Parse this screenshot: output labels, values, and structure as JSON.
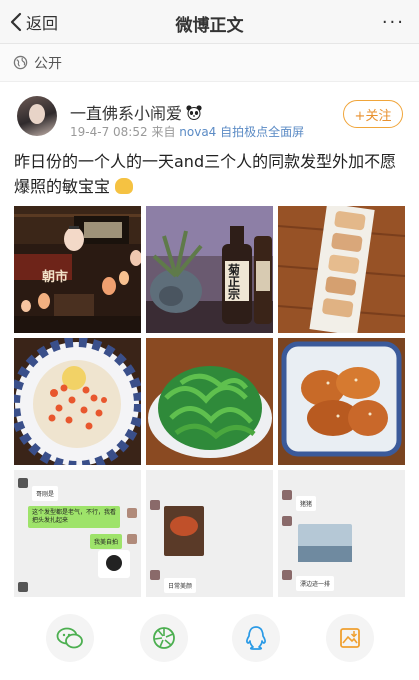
{
  "nav": {
    "back_label": "返回",
    "title": "微博正文",
    "more": "···"
  },
  "visibility": {
    "label": "公开"
  },
  "post": {
    "username": "一直佛系小闹爱",
    "time": "19-4-7 08:52",
    "source_prefix": "来自",
    "device": "nova4 自拍极点全面屏",
    "follow_label": "+关注",
    "text": "昨日份的一个人的一天and三个人的同款发型外加不愿爆照的敏宝宝"
  },
  "photos": {
    "p2_sign": "朝市",
    "p3_label": "菊正宗",
    "chat_left": {
      "m1": "哥刚是",
      "m2": "这个发型都是老气，不行，我看把头发扎起来",
      "m3": "我美自拍"
    },
    "chat_mid": {
      "m1": "日常美颜"
    },
    "chat_right": {
      "m1": "猪猪",
      "m2": "漂边迹一排"
    }
  },
  "colors": {
    "accent": "#e8912f",
    "link": "#5b8bc5"
  },
  "toolbar_icons": [
    "wechat-icon",
    "moments-icon",
    "qq-icon",
    "save-image-icon"
  ]
}
